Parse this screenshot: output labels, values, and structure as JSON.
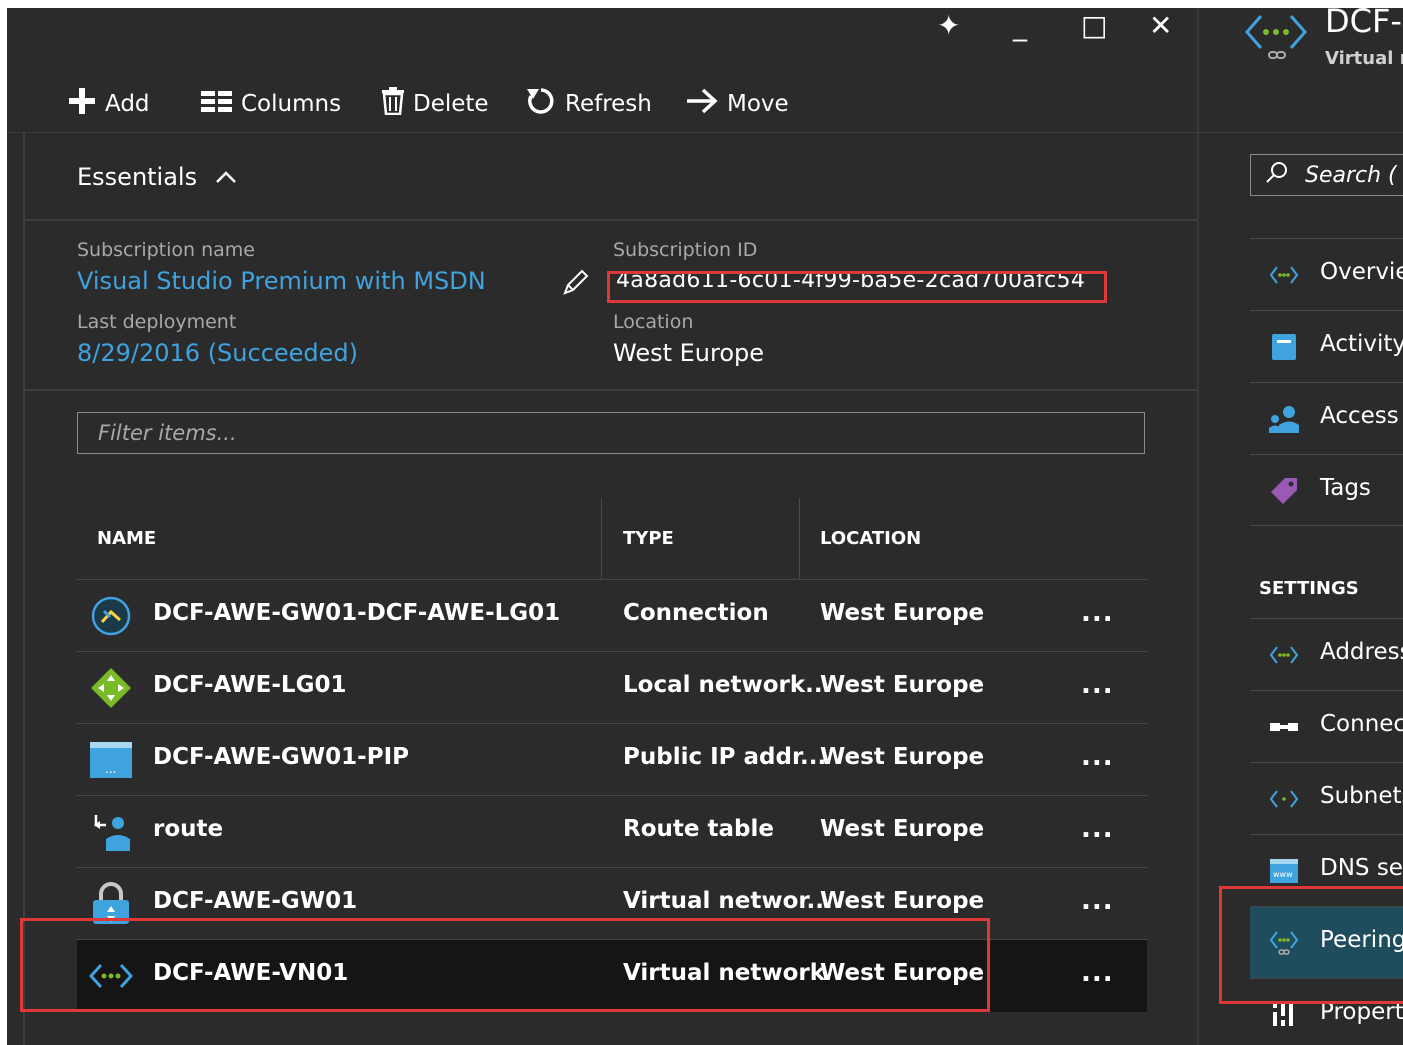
{
  "window_controls": {
    "pin": "✦",
    "minimize": "_",
    "maximize": "□",
    "close": "✕"
  },
  "toolbar": {
    "add_label": "Add",
    "columns_label": "Columns",
    "delete_label": "Delete",
    "refresh_label": "Refresh",
    "move_label": "Move"
  },
  "essentials": {
    "header": "Essentials",
    "subscription_name_label": "Subscription name",
    "subscription_name": "Visual Studio Premium with MSDN",
    "subscription_id_label": "Subscription ID",
    "subscription_id": "4a8ad611-6c01-4f99-ba5e-2cad700afc54",
    "last_deployment_label": "Last deployment",
    "last_deployment": "8/29/2016 (Succeeded)",
    "location_label": "Location",
    "location": "West Europe"
  },
  "filter": {
    "placeholder": "Filter items..."
  },
  "table": {
    "headers": {
      "name": "NAME",
      "type": "TYPE",
      "location": "LOCATION"
    },
    "rows": [
      {
        "icon": "connection-icon",
        "name": "DCF-AWE-GW01-DCF-AWE-LG01",
        "type": "Connection",
        "location": "West Europe",
        "more": "..."
      },
      {
        "icon": "local-network-gateway-icon",
        "name": "DCF-AWE-LG01",
        "type": "Local network...",
        "location": "West Europe",
        "more": "..."
      },
      {
        "icon": "public-ip-icon",
        "name": "DCF-AWE-GW01-PIP",
        "type": "Public IP addr...",
        "location": "West Europe",
        "more": "..."
      },
      {
        "icon": "route-table-icon",
        "name": "route",
        "type": "Route table",
        "location": "West Europe",
        "more": "..."
      },
      {
        "icon": "vnet-gateway-icon",
        "name": "DCF-AWE-GW01",
        "type": "Virtual networ...",
        "location": "West Europe",
        "more": "..."
      },
      {
        "icon": "virtual-network-icon",
        "name": "DCF-AWE-VN01",
        "type": "Virtual network",
        "location": "West Europe",
        "more": "...",
        "selected": true
      }
    ]
  },
  "right_pane": {
    "title": "DCF-",
    "subtitle": "Virtual n",
    "search_placeholder": "Search (",
    "nav": [
      {
        "label": "Overview",
        "icon": "overview-icon"
      },
      {
        "label": "Activity",
        "icon": "activity-log-icon"
      },
      {
        "label": "Access c",
        "icon": "access-control-icon"
      },
      {
        "label": "Tags",
        "icon": "tag-icon"
      }
    ],
    "settings_header": "SETTINGS",
    "settings_nav": [
      {
        "label": "Address",
        "icon": "address-space-icon"
      },
      {
        "label": "Connect",
        "icon": "connected-devices-icon"
      },
      {
        "label": "Subnets",
        "icon": "subnets-icon"
      },
      {
        "label": "DNS ser",
        "icon": "dns-servers-icon"
      },
      {
        "label": "Peerings",
        "icon": "peerings-icon",
        "selected": true
      },
      {
        "label": "Properti",
        "icon": "properties-icon"
      }
    ]
  },
  "colors": {
    "background": "#2b2b2b",
    "link": "#3fa3df",
    "highlight": "#e03838",
    "selected_nav": "#1f4d5e"
  }
}
